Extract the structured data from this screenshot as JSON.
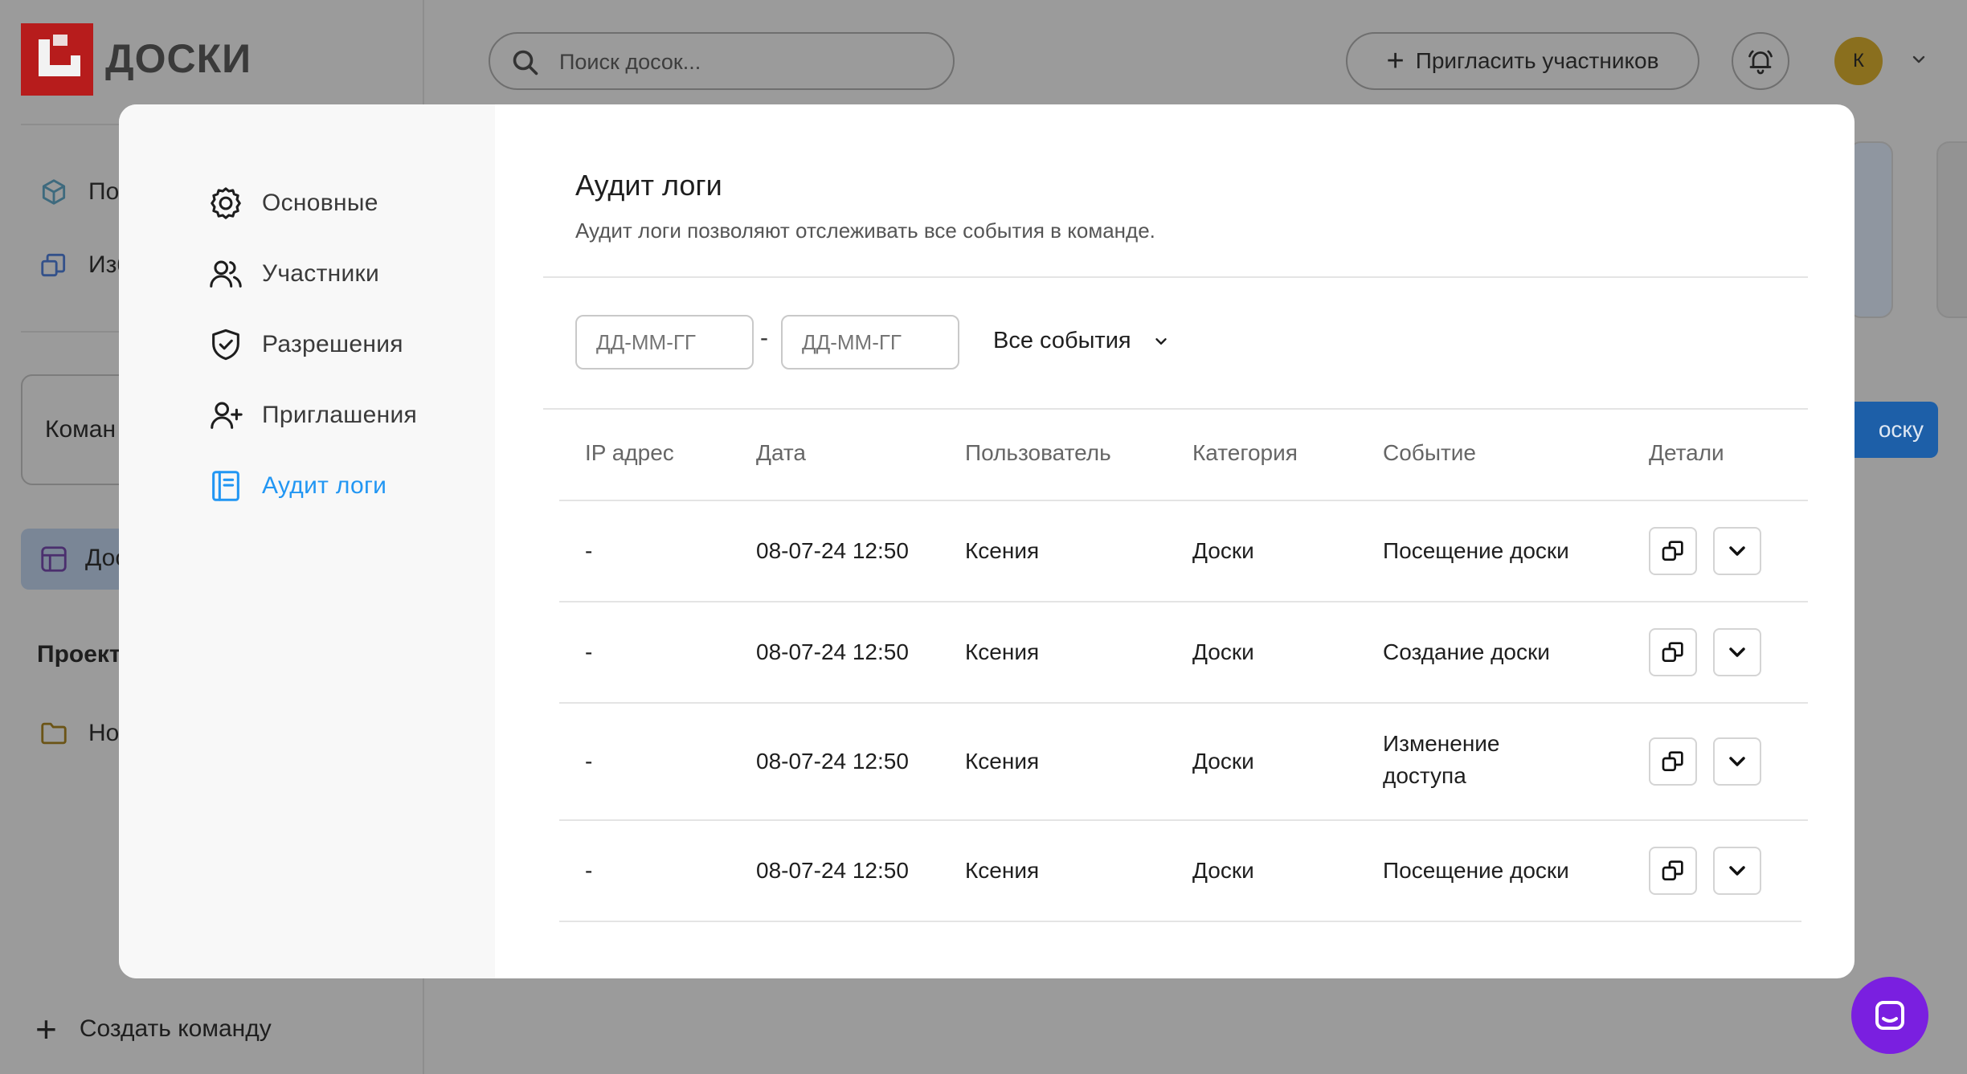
{
  "app": {
    "logo_text": "ДОСКИ",
    "search_placeholder": "Поиск досок...",
    "invite_label": "Пригласить участников",
    "avatar_initial": "К",
    "sidebar": {
      "item1": "Пос",
      "item2": "Изб",
      "team": "Коман",
      "boards": "Дос",
      "projects": "Проект",
      "folder": "Но",
      "create_team": "Создать команду"
    },
    "blue_button_fragment": "оску"
  },
  "modal": {
    "nav": [
      {
        "label": "Основные",
        "icon": "gear-icon"
      },
      {
        "label": "Участники",
        "icon": "users-icon"
      },
      {
        "label": "Разрешения",
        "icon": "shield-check-icon"
      },
      {
        "label": "Приглашения",
        "icon": "user-plus-icon"
      },
      {
        "label": "Аудит логи",
        "icon": "log-icon",
        "active": true
      }
    ],
    "title": "Аудит логи",
    "subtitle": "Аудит логи позволяют отслеживать все события в команде.",
    "filters": {
      "date_from_placeholder": "ДД-ММ-ГГ",
      "date_to_placeholder": "ДД-ММ-ГГ",
      "separator": "-",
      "events_label": "Все события"
    },
    "table": {
      "headers": [
        "IP адрес",
        "Дата",
        "Пользователь",
        "Категория",
        "Событие",
        "Детали"
      ],
      "rows": [
        {
          "ip": "-",
          "date": "08-07-24 12:50",
          "user": "Ксения",
          "category": "Доски",
          "event": "Посещение доски"
        },
        {
          "ip": "-",
          "date": "08-07-24 12:50",
          "user": "Ксения",
          "category": "Доски",
          "event": "Создание доски"
        },
        {
          "ip": "-",
          "date": "08-07-24 12:50",
          "user": "Ксения",
          "category": "Доски",
          "event": "Изменение доступа"
        },
        {
          "ip": "-",
          "date": "08-07-24 12:50",
          "user": "Ксения",
          "category": "Доски",
          "event": "Посещение доски"
        }
      ]
    }
  }
}
